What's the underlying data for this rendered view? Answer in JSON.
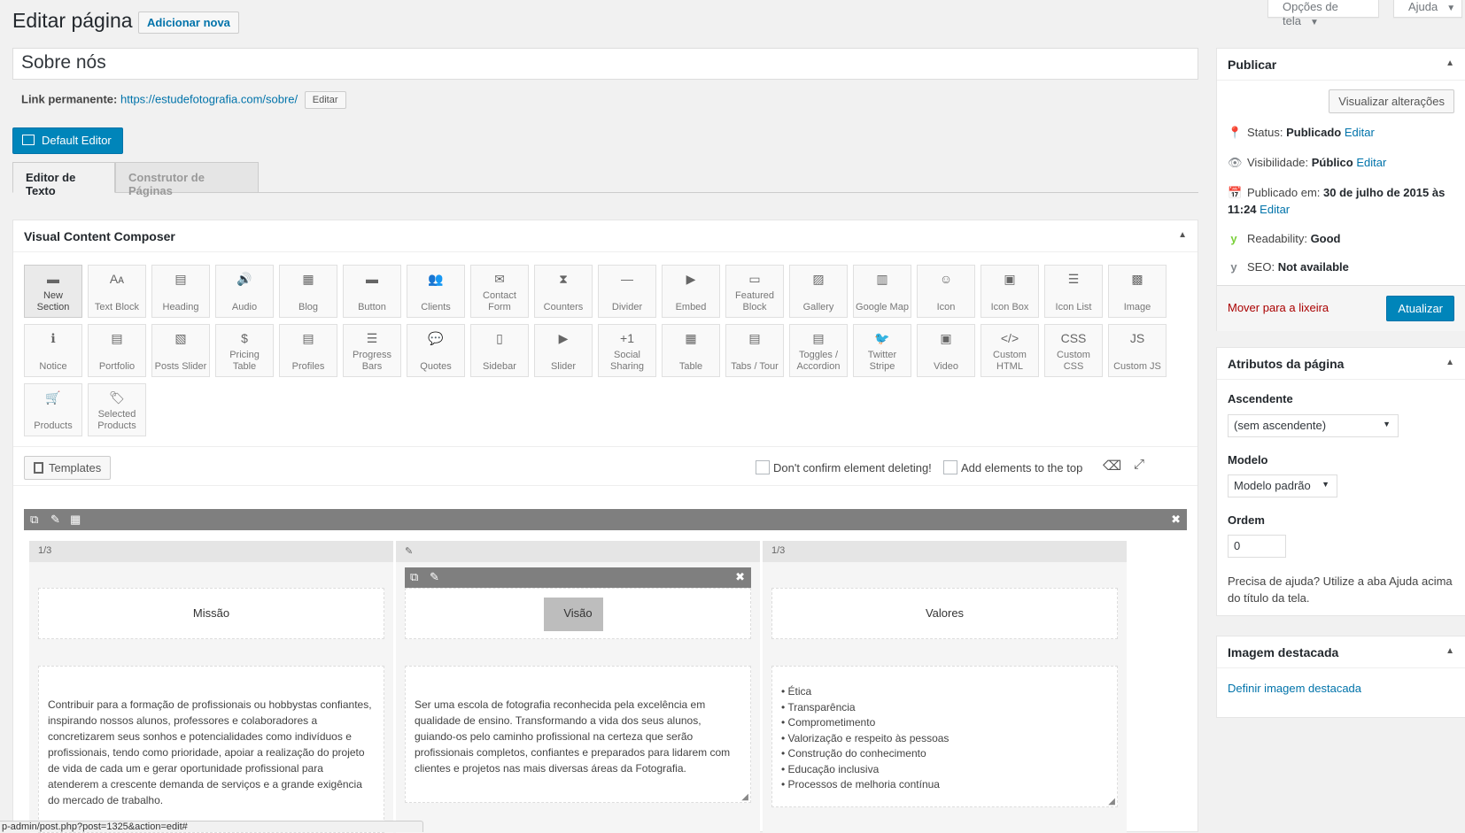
{
  "screen_options": {
    "label": "Opções de tela"
  },
  "help": {
    "label": "Ajuda"
  },
  "page_title": "Editar página",
  "add_new": "Adicionar nova",
  "post_title": "Sobre nós",
  "permalink": {
    "label": "Link permanente:",
    "url": "https://estudefotografia.com/sobre/",
    "edit": "Editar"
  },
  "default_editor": "Default Editor",
  "tabs": [
    {
      "label": "Editor de Texto"
    },
    {
      "label": "Construtor de Páginas"
    }
  ],
  "composer": {
    "title": "Visual Content Composer",
    "elements": [
      {
        "label": "New Section",
        "icon": "▬"
      },
      {
        "label": "Text Block",
        "icon": "Aᴀ"
      },
      {
        "label": "Heading",
        "icon": "▤"
      },
      {
        "label": "Audio",
        "icon": "🔊"
      },
      {
        "label": "Blog",
        "icon": "▦"
      },
      {
        "label": "Button",
        "icon": "▬"
      },
      {
        "label": "Clients",
        "icon": "👥"
      },
      {
        "label": "Contact Form",
        "icon": "✉"
      },
      {
        "label": "Counters",
        "icon": "⧗"
      },
      {
        "label": "Divider",
        "icon": "—"
      },
      {
        "label": "Embed",
        "icon": "▶"
      },
      {
        "label": "Featured Block",
        "icon": "▭"
      },
      {
        "label": "Gallery",
        "icon": "▨"
      },
      {
        "label": "Google Map",
        "icon": "▥"
      },
      {
        "label": "Icon",
        "icon": "☺"
      },
      {
        "label": "Icon Box",
        "icon": "▣"
      },
      {
        "label": "Icon List",
        "icon": "☰"
      },
      {
        "label": "Image",
        "icon": "▩"
      },
      {
        "label": "Notice",
        "icon": "ℹ"
      },
      {
        "label": "Portfolio",
        "icon": "▤"
      },
      {
        "label": "Posts Slider",
        "icon": "▧"
      },
      {
        "label": "Pricing Table",
        "icon": "$"
      },
      {
        "label": "Profiles",
        "icon": "▤"
      },
      {
        "label": "Progress Bars",
        "icon": "☰"
      },
      {
        "label": "Quotes",
        "icon": "💬"
      },
      {
        "label": "Sidebar",
        "icon": "▯"
      },
      {
        "label": "Slider",
        "icon": "▶"
      },
      {
        "label": "Social Sharing",
        "icon": "+1"
      },
      {
        "label": "Table",
        "icon": "▦"
      },
      {
        "label": "Tabs / Tour",
        "icon": "▤"
      },
      {
        "label": "Toggles / Accordion",
        "icon": "▤"
      },
      {
        "label": "Twitter Stripe",
        "icon": "🐦"
      },
      {
        "label": "Video",
        "icon": "▣"
      },
      {
        "label": "Custom HTML",
        "icon": "</>"
      },
      {
        "label": "Custom CSS",
        "icon": "CSS"
      },
      {
        "label": "Custom JS",
        "icon": "JS"
      },
      {
        "label": "Products",
        "icon": "🛒"
      },
      {
        "label": "Selected Products",
        "icon": "🏷"
      }
    ],
    "templates": "Templates",
    "dont_confirm": "Don't confirm element deleting!",
    "add_top": "Add elements to the top",
    "columns": [
      {
        "head": "1/3",
        "heading": "Missão",
        "text": "Contribuir para a formação de profissionais ou hobbystas confiantes, inspirando nossos alunos, professores e colaboradores a concretizarem seus sonhos e potencialidades como indivíduos e profissionais, tendo como prioridade, apoiar a realização do projeto de vida de cada um e gerar oportunidade profissional para atenderem a crescente demanda de serviços e a grande exigência do mercado de trabalho."
      },
      {
        "head": "",
        "heading": "Visão",
        "text": "Ser uma escola de fotografia reconhecida pela excelência em qualidade de ensino. Transformando a vida dos seus alunos, guiando-os pelo caminho profissional na certeza que serão profissionais completos, confiantes e preparados para lidarem com clientes e projetos nas mais diversas áreas da Fotografia."
      },
      {
        "head": "1/3",
        "heading": "Valores",
        "items": [
          "• Ética",
          "• Transparência",
          "• Comprometimento",
          "• Valorização e respeito às pessoas",
          "• Construção do conhecimento",
          "• Educação inclusiva",
          "• Processos de melhoria contínua"
        ]
      }
    ]
  },
  "publish": {
    "title": "Publicar",
    "preview": "Visualizar alterações",
    "status_label": "Status:",
    "status_value": "Publicado",
    "edit": "Editar",
    "visibility_label": "Visibilidade:",
    "visibility_value": "Público",
    "published_label": "Publicado em:",
    "published_value": "30 de julho de 2015 às",
    "published_time": "11:24",
    "readability_label": "Readability:",
    "readability_value": "Good",
    "seo_label": "SEO:",
    "seo_value": "Not available",
    "trash": "Mover para a lixeira",
    "update": "Atualizar"
  },
  "attributes": {
    "title": "Atributos da página",
    "parent_label": "Ascendente",
    "parent_value": "(sem ascendente)",
    "template_label": "Modelo",
    "template_value": "Modelo padrão",
    "order_label": "Ordem",
    "order_value": "0",
    "help": "Precisa de ajuda? Utilize a aba Ajuda acima do título da tela."
  },
  "featured": {
    "title": "Imagem destacada",
    "link": "Definir imagem destacada"
  },
  "status_url": "p-admin/post.php?post=1325&action=edit#"
}
